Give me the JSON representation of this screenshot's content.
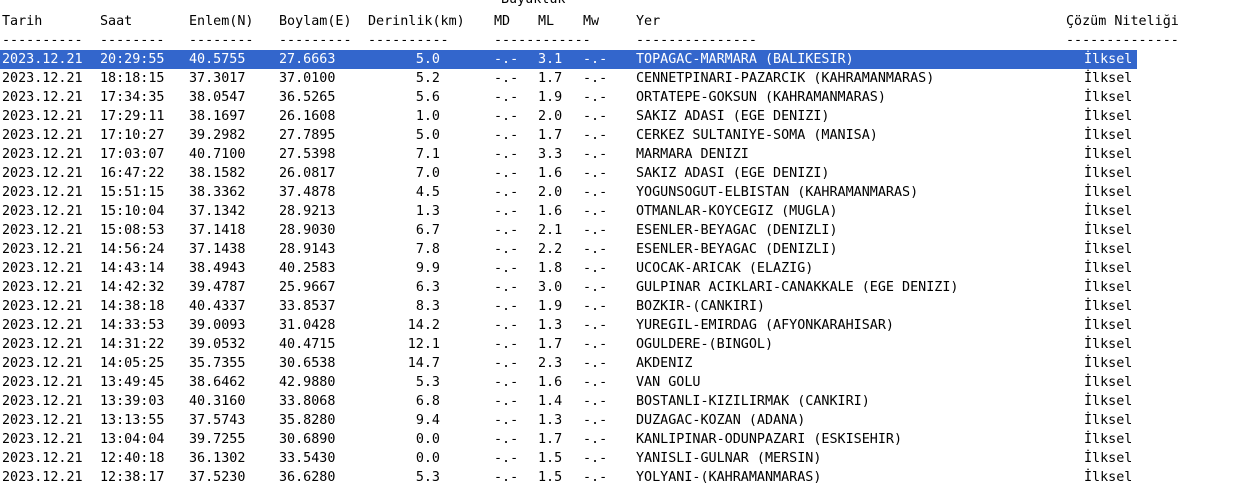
{
  "header": {
    "group_label": "Büyüklük",
    "columns": {
      "tarih": "Tarih",
      "saat": "Saat",
      "enlem": "Enlem(N)",
      "boylam": "Boylam(E)",
      "derinlik": "Derinlik(km)",
      "md": "MD",
      "ml": "ML",
      "mw": "Mw",
      "yer": "Yer",
      "nitelik": "Çözüm Niteliği"
    },
    "dashes": {
      "tarih": "----------",
      "saat": "--------",
      "enlem": "--------",
      "boylam": "---------",
      "derinlik": "----------",
      "buyukluk": "------------",
      "yer": "---------------",
      "nitelik": "--------------"
    }
  },
  "rows": [
    {
      "tarih": "2023.12.21",
      "saat": "20:29:55",
      "enlem": "40.5755",
      "boylam": "27.6663",
      "derinlik": "5.0",
      "md": "-.-",
      "ml": "3.1",
      "mw": "-.-",
      "yer": "TOPAGAC-MARMARA (BALIKESIR)",
      "nitelik": "İlksel"
    },
    {
      "tarih": "2023.12.21",
      "saat": "18:18:15",
      "enlem": "37.3017",
      "boylam": "37.0100",
      "derinlik": "5.2",
      "md": "-.-",
      "ml": "1.7",
      "mw": "-.-",
      "yer": "CENNETPINARI-PAZARCIK (KAHRAMANMARAS)",
      "nitelik": "İlksel"
    },
    {
      "tarih": "2023.12.21",
      "saat": "17:34:35",
      "enlem": "38.0547",
      "boylam": "36.5265",
      "derinlik": "5.6",
      "md": "-.-",
      "ml": "1.9",
      "mw": "-.-",
      "yer": "ORTATEPE-GOKSUN (KAHRAMANMARAS)",
      "nitelik": "İlksel"
    },
    {
      "tarih": "2023.12.21",
      "saat": "17:29:11",
      "enlem": "38.1697",
      "boylam": "26.1608",
      "derinlik": "1.0",
      "md": "-.-",
      "ml": "2.0",
      "mw": "-.-",
      "yer": "SAKIZ ADASI (EGE DENIZI)",
      "nitelik": "İlksel"
    },
    {
      "tarih": "2023.12.21",
      "saat": "17:10:27",
      "enlem": "39.2982",
      "boylam": "27.7895",
      "derinlik": "5.0",
      "md": "-.-",
      "ml": "1.7",
      "mw": "-.-",
      "yer": "CERKEZ SULTANIYE-SOMA (MANISA)",
      "nitelik": "İlksel"
    },
    {
      "tarih": "2023.12.21",
      "saat": "17:03:07",
      "enlem": "40.7100",
      "boylam": "27.5398",
      "derinlik": "7.1",
      "md": "-.-",
      "ml": "3.3",
      "mw": "-.-",
      "yer": "MARMARA DENIZI",
      "nitelik": "İlksel"
    },
    {
      "tarih": "2023.12.21",
      "saat": "16:47:22",
      "enlem": "38.1582",
      "boylam": "26.0817",
      "derinlik": "7.0",
      "md": "-.-",
      "ml": "1.6",
      "mw": "-.-",
      "yer": "SAKIZ ADASI (EGE DENIZI)",
      "nitelik": "İlksel"
    },
    {
      "tarih": "2023.12.21",
      "saat": "15:51:15",
      "enlem": "38.3362",
      "boylam": "37.4878",
      "derinlik": "4.5",
      "md": "-.-",
      "ml": "2.0",
      "mw": "-.-",
      "yer": "YOGUNSOGUT-ELBISTAN (KAHRAMANMARAS)",
      "nitelik": "İlksel"
    },
    {
      "tarih": "2023.12.21",
      "saat": "15:10:04",
      "enlem": "37.1342",
      "boylam": "28.9213",
      "derinlik": "1.3",
      "md": "-.-",
      "ml": "1.6",
      "mw": "-.-",
      "yer": "OTMANLAR-KOYCEGIZ (MUGLA)",
      "nitelik": "İlksel"
    },
    {
      "tarih": "2023.12.21",
      "saat": "15:08:53",
      "enlem": "37.1418",
      "boylam": "28.9030",
      "derinlik": "6.7",
      "md": "-.-",
      "ml": "2.1",
      "mw": "-.-",
      "yer": "ESENLER-BEYAGAC (DENIZLI)",
      "nitelik": "İlksel"
    },
    {
      "tarih": "2023.12.21",
      "saat": "14:56:24",
      "enlem": "37.1438",
      "boylam": "28.9143",
      "derinlik": "7.8",
      "md": "-.-",
      "ml": "2.2",
      "mw": "-.-",
      "yer": "ESENLER-BEYAGAC (DENIZLI)",
      "nitelik": "İlksel"
    },
    {
      "tarih": "2023.12.21",
      "saat": "14:43:14",
      "enlem": "38.4943",
      "boylam": "40.2583",
      "derinlik": "9.9",
      "md": "-.-",
      "ml": "1.8",
      "mw": "-.-",
      "yer": "UCOCAK-ARICAK (ELAZIG)",
      "nitelik": "İlksel"
    },
    {
      "tarih": "2023.12.21",
      "saat": "14:42:32",
      "enlem": "39.4787",
      "boylam": "25.9667",
      "derinlik": "6.3",
      "md": "-.-",
      "ml": "3.0",
      "mw": "-.-",
      "yer": "GULPINAR ACIKLARI-CANAKKALE (EGE DENIZI)",
      "nitelik": "İlksel"
    },
    {
      "tarih": "2023.12.21",
      "saat": "14:38:18",
      "enlem": "40.4337",
      "boylam": "33.8537",
      "derinlik": "8.3",
      "md": "-.-",
      "ml": "1.9",
      "mw": "-.-",
      "yer": "BOZKIR-(CANKIRI)",
      "nitelik": "İlksel"
    },
    {
      "tarih": "2023.12.21",
      "saat": "14:33:53",
      "enlem": "39.0093",
      "boylam": "31.0428",
      "derinlik": "14.2",
      "md": "-.-",
      "ml": "1.3",
      "mw": "-.-",
      "yer": "YUREGIL-EMIRDAG (AFYONKARAHISAR)",
      "nitelik": "İlksel"
    },
    {
      "tarih": "2023.12.21",
      "saat": "14:31:22",
      "enlem": "39.0532",
      "boylam": "40.4715",
      "derinlik": "12.1",
      "md": "-.-",
      "ml": "1.7",
      "mw": "-.-",
      "yer": "OGULDERE-(BINGOL)",
      "nitelik": "İlksel"
    },
    {
      "tarih": "2023.12.21",
      "saat": "14:05:25",
      "enlem": "35.7355",
      "boylam": "30.6538",
      "derinlik": "14.7",
      "md": "-.-",
      "ml": "2.3",
      "mw": "-.-",
      "yer": "AKDENIZ",
      "nitelik": "İlksel"
    },
    {
      "tarih": "2023.12.21",
      "saat": "13:49:45",
      "enlem": "38.6462",
      "boylam": "42.9880",
      "derinlik": "5.3",
      "md": "-.-",
      "ml": "1.6",
      "mw": "-.-",
      "yer": "VAN GOLU",
      "nitelik": "İlksel"
    },
    {
      "tarih": "2023.12.21",
      "saat": "13:39:03",
      "enlem": "40.3160",
      "boylam": "33.8068",
      "derinlik": "6.8",
      "md": "-.-",
      "ml": "1.4",
      "mw": "-.-",
      "yer": "BOSTANLI-KIZILIRMAK (CANKIRI)",
      "nitelik": "İlksel"
    },
    {
      "tarih": "2023.12.21",
      "saat": "13:13:55",
      "enlem": "37.5743",
      "boylam": "35.8280",
      "derinlik": "9.4",
      "md": "-.-",
      "ml": "1.3",
      "mw": "-.-",
      "yer": "DUZAGAC-KOZAN (ADANA)",
      "nitelik": "İlksel"
    },
    {
      "tarih": "2023.12.21",
      "saat": "13:04:04",
      "enlem": "39.7255",
      "boylam": "30.6890",
      "derinlik": "0.0",
      "md": "-.-",
      "ml": "1.7",
      "mw": "-.-",
      "yer": "KANLIPINAR-ODUNPAZARI (ESKISEHIR)",
      "nitelik": "İlksel"
    },
    {
      "tarih": "2023.12.21",
      "saat": "12:40:18",
      "enlem": "36.1302",
      "boylam": "33.5430",
      "derinlik": "0.0",
      "md": "-.-",
      "ml": "1.5",
      "mw": "-.-",
      "yer": "YANISLI-GULNAR (MERSIN)",
      "nitelik": "İlksel"
    },
    {
      "tarih": "2023.12.21",
      "saat": "12:38:17",
      "enlem": "37.5230",
      "boylam": "36.6280",
      "derinlik": "5.3",
      "md": "-.-",
      "ml": "1.5",
      "mw": "-.-",
      "yer": "YOLYANI-(KAHRAMANMARAS)",
      "nitelik": "İlksel"
    }
  ],
  "selected_row_index": 0,
  "colors": {
    "selection_background": "#3366cc",
    "selection_text": "#ffffff",
    "text": "#000000",
    "background": "#ffffff"
  }
}
